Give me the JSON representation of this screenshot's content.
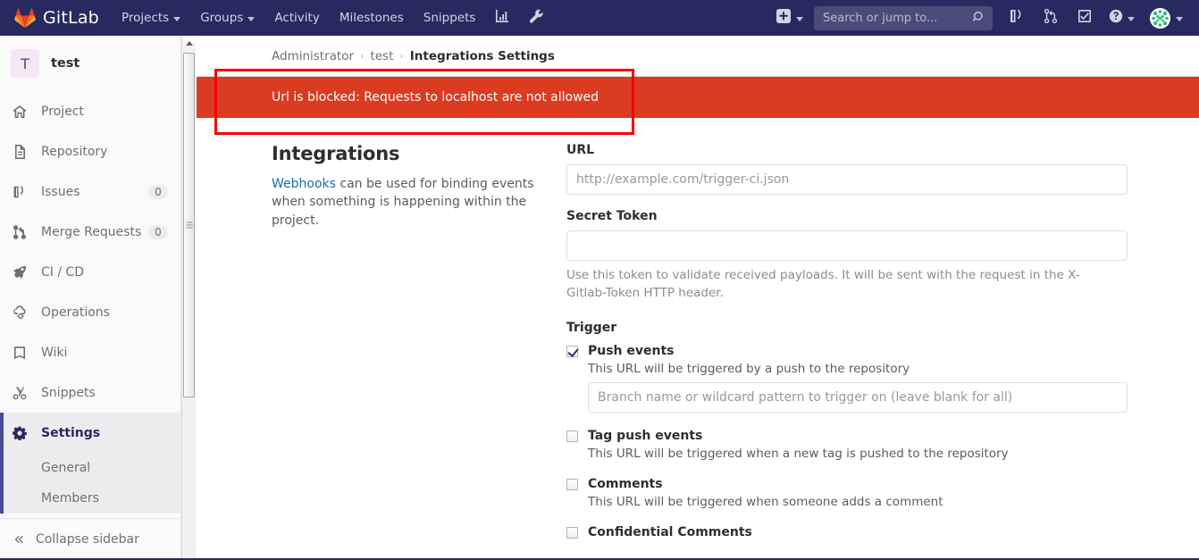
{
  "navbar": {
    "brand": "GitLab",
    "brand_logo_icon": "gitlab-tanuki-logo",
    "items": [
      {
        "label": "Projects",
        "has_caret": true,
        "name": "nav-projects"
      },
      {
        "label": "Groups",
        "has_caret": true,
        "name": "nav-groups"
      },
      {
        "label": "Activity",
        "has_caret": false,
        "name": "nav-activity"
      },
      {
        "label": "Milestones",
        "has_caret": false,
        "name": "nav-milestones"
      },
      {
        "label": "Snippets",
        "has_caret": false,
        "name": "nav-snippets"
      }
    ],
    "icon_buttons": [
      {
        "icon": "chart-icon"
      },
      {
        "icon": "wrench-icon"
      }
    ],
    "right": {
      "new_icon": "plus-square-icon",
      "search_placeholder": "Search or jump to...",
      "search_value": "",
      "search_icon": "search-icon",
      "issues_icon": "issues-icon",
      "merge_requests_icon": "merge-request-icon",
      "todos_icon": "todo-check-icon",
      "help_icon": "question-circle-icon",
      "avatar_icon": "user-avatar"
    }
  },
  "sidebar": {
    "project_initial": "T",
    "project_name": "test",
    "items": [
      {
        "label": "Project",
        "icon": "home-icon",
        "badge": ""
      },
      {
        "label": "Repository",
        "icon": "document-icon",
        "badge": ""
      },
      {
        "label": "Issues",
        "icon": "issues-icon",
        "badge": "0"
      },
      {
        "label": "Merge Requests",
        "icon": "merge-icon",
        "badge": "0"
      },
      {
        "label": "CI / CD",
        "icon": "rocket-icon",
        "badge": ""
      },
      {
        "label": "Operations",
        "icon": "cloud-gear-icon",
        "badge": ""
      },
      {
        "label": "Wiki",
        "icon": "book-icon",
        "badge": ""
      },
      {
        "label": "Snippets",
        "icon": "scissors-icon",
        "badge": ""
      },
      {
        "label": "Settings",
        "icon": "gear-icon",
        "badge": "",
        "active": true
      }
    ],
    "sub_items": [
      {
        "label": "General"
      },
      {
        "label": "Members"
      }
    ],
    "collapse_label": "Collapse sidebar",
    "collapse_icon": "double-chevron-left-icon"
  },
  "breadcrumb": {
    "items": [
      "Administrator",
      "test"
    ],
    "current": "Integrations Settings",
    "separator": "›"
  },
  "alert": {
    "message": "Url is blocked: Requests to localhost are not allowed",
    "background_color": "#db3b21",
    "text_color": "#ffffff"
  },
  "annotation": {
    "color": "#f50000",
    "target": "alert-banner"
  },
  "panel": {
    "title": "Integrations",
    "desc_link": "Webhooks",
    "desc_rest": " can be used for binding events when something is happening within the project."
  },
  "form": {
    "url": {
      "label": "URL",
      "placeholder": "http://example.com/trigger-ci.json",
      "value": ""
    },
    "secret_token": {
      "label": "Secret Token",
      "placeholder": "",
      "value": "",
      "help": "Use this token to validate received payloads. It will be sent with the request in the X-Gitlab-Token HTTP header."
    },
    "trigger_title": "Trigger",
    "triggers": [
      {
        "label": "Push events",
        "checked": true,
        "desc": "This URL will be triggered by a push to the repository",
        "input_placeholder": "Branch name or wildcard pattern to trigger on (leave blank for all)",
        "input_value": ""
      },
      {
        "label": "Tag push events",
        "checked": false,
        "desc": "This URL will be triggered when a new tag is pushed to the repository"
      },
      {
        "label": "Comments",
        "checked": false,
        "desc": "This URL will be triggered when someone adds a comment"
      },
      {
        "label": "Confidential Comments",
        "checked": false,
        "desc": ""
      }
    ]
  }
}
